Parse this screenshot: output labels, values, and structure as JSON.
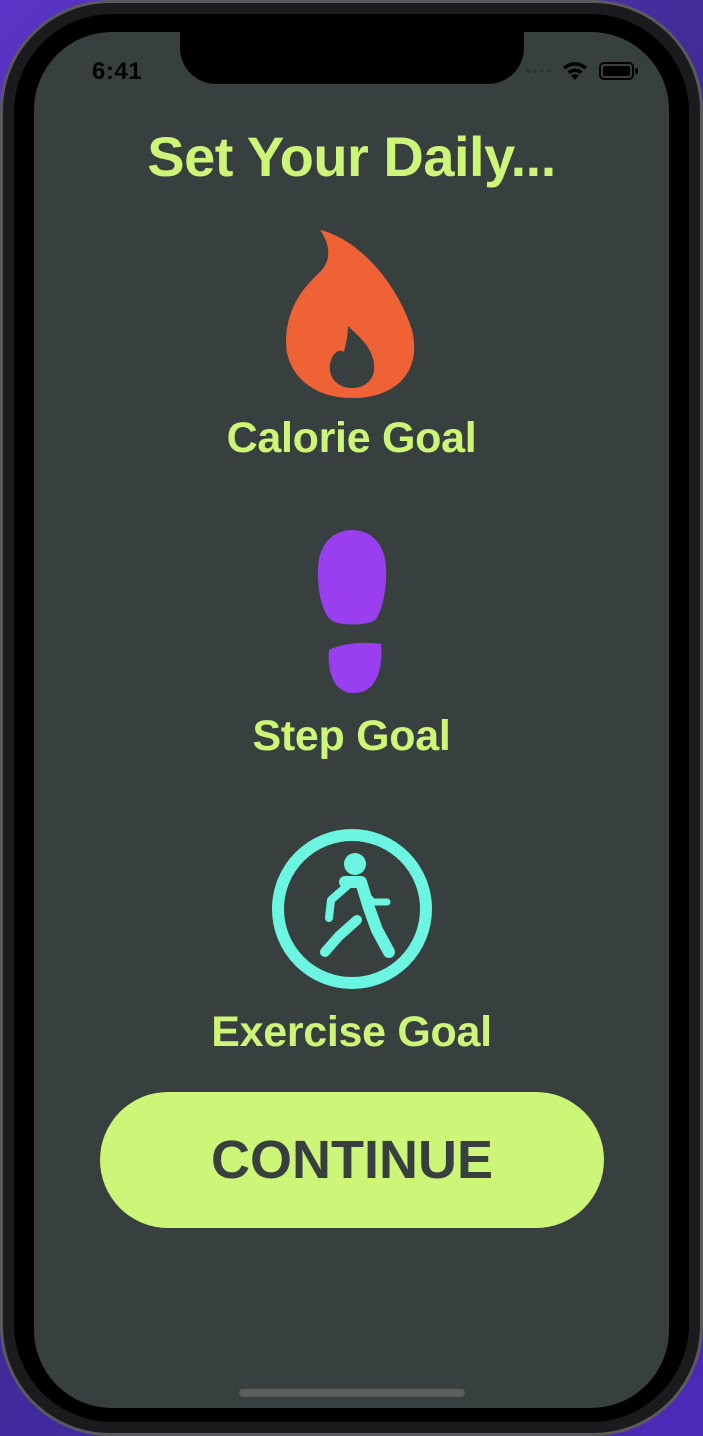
{
  "status_bar": {
    "time": "6:41",
    "icons": [
      "cellular-dots-icon",
      "wifi-icon",
      "battery-icon"
    ]
  },
  "screen": {
    "title": "Set Your Daily...",
    "background_color": "#38403f",
    "accent_color": "#cdf577"
  },
  "goals": [
    {
      "label": "Calorie Goal",
      "icon": "flame-icon",
      "color": "#ee6236"
    },
    {
      "label": "Step Goal",
      "icon": "footprint-icon",
      "color": "#9a3ff0"
    },
    {
      "label": "Exercise Goal",
      "icon": "walking-figure-icon",
      "color": "#6cf6e2"
    }
  ],
  "continue_button": {
    "label": "CONTINUE"
  }
}
